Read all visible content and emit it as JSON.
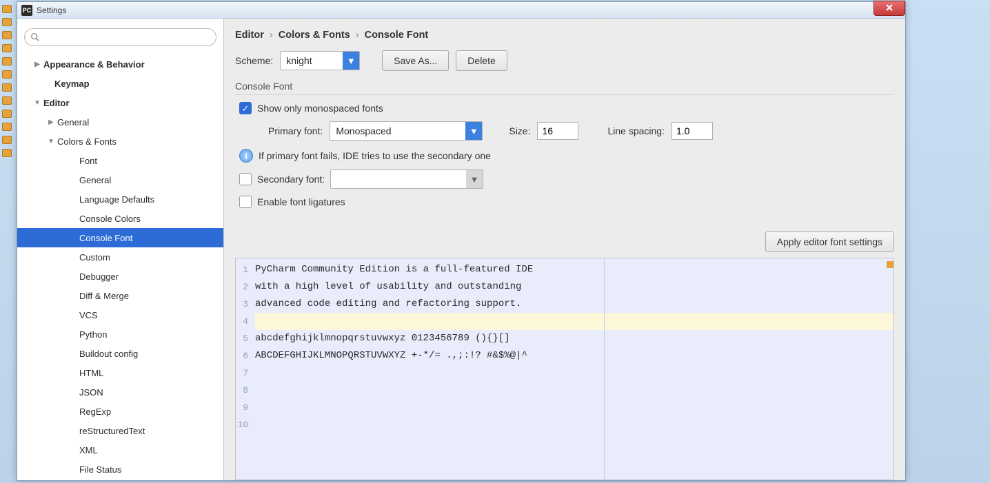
{
  "window": {
    "title": "Settings"
  },
  "sidebar": {
    "search_placeholder": "",
    "items": [
      {
        "pad": 38,
        "bold": true,
        "arrow": "▶",
        "label": "Appearance & Behavior"
      },
      {
        "pad": 54,
        "bold": true,
        "arrow": "",
        "label": "Keymap"
      },
      {
        "pad": 38,
        "bold": true,
        "arrow": "▼",
        "label": "Editor"
      },
      {
        "pad": 58,
        "bold": false,
        "arrow": "▶",
        "label": "General"
      },
      {
        "pad": 58,
        "bold": false,
        "arrow": "▼",
        "label": "Colors & Fonts"
      },
      {
        "pad": 90,
        "bold": false,
        "arrow": "",
        "label": "Font"
      },
      {
        "pad": 90,
        "bold": false,
        "arrow": "",
        "label": "General"
      },
      {
        "pad": 90,
        "bold": false,
        "arrow": "",
        "label": "Language Defaults"
      },
      {
        "pad": 90,
        "bold": false,
        "arrow": "",
        "label": "Console Colors"
      },
      {
        "pad": 90,
        "bold": false,
        "arrow": "",
        "label": "Console Font",
        "selected": true
      },
      {
        "pad": 90,
        "bold": false,
        "arrow": "",
        "label": "Custom"
      },
      {
        "pad": 90,
        "bold": false,
        "arrow": "",
        "label": "Debugger"
      },
      {
        "pad": 90,
        "bold": false,
        "arrow": "",
        "label": "Diff & Merge"
      },
      {
        "pad": 90,
        "bold": false,
        "arrow": "",
        "label": "VCS"
      },
      {
        "pad": 90,
        "bold": false,
        "arrow": "",
        "label": "Python"
      },
      {
        "pad": 90,
        "bold": false,
        "arrow": "",
        "label": "Buildout config"
      },
      {
        "pad": 90,
        "bold": false,
        "arrow": "",
        "label": "HTML"
      },
      {
        "pad": 90,
        "bold": false,
        "arrow": "",
        "label": "JSON"
      },
      {
        "pad": 90,
        "bold": false,
        "arrow": "",
        "label": "RegExp"
      },
      {
        "pad": 90,
        "bold": false,
        "arrow": "",
        "label": "reStructuredText"
      },
      {
        "pad": 90,
        "bold": false,
        "arrow": "",
        "label": "XML"
      },
      {
        "pad": 90,
        "bold": false,
        "arrow": "",
        "label": "File Status"
      }
    ]
  },
  "breadcrumb": {
    "a": "Editor",
    "b": "Colors & Fonts",
    "c": "Console Font"
  },
  "form": {
    "scheme_label": "Scheme:",
    "scheme_value": "knight",
    "save_as": "Save As...",
    "delete": "Delete",
    "section": "Console Font",
    "show_mono": "Show only monospaced fonts",
    "primary_label": "Primary font:",
    "primary_value": "Monospaced",
    "size_label": "Size:",
    "size_value": "16",
    "spacing_label": "Line spacing:",
    "spacing_value": "1.0",
    "info_text": "If primary font fails, IDE tries to use the secondary one",
    "secondary_label": "Secondary font:",
    "secondary_value": "",
    "ligatures": "Enable font ligatures",
    "apply_editor": "Apply editor font settings"
  },
  "preview": {
    "lines": [
      "PyCharm Community Edition is a full-featured IDE",
      "with a high level of usability and outstanding",
      "advanced code editing and refactoring support.",
      "",
      "abcdefghijklmnopqrstuvwxyz 0123456789 (){}[]",
      "ABCDEFGHIJKLMNOPQRSTUVWXYZ +-*/= .,;:!? #&$%@|^",
      "",
      "",
      "",
      ""
    ],
    "current_line": 4
  }
}
